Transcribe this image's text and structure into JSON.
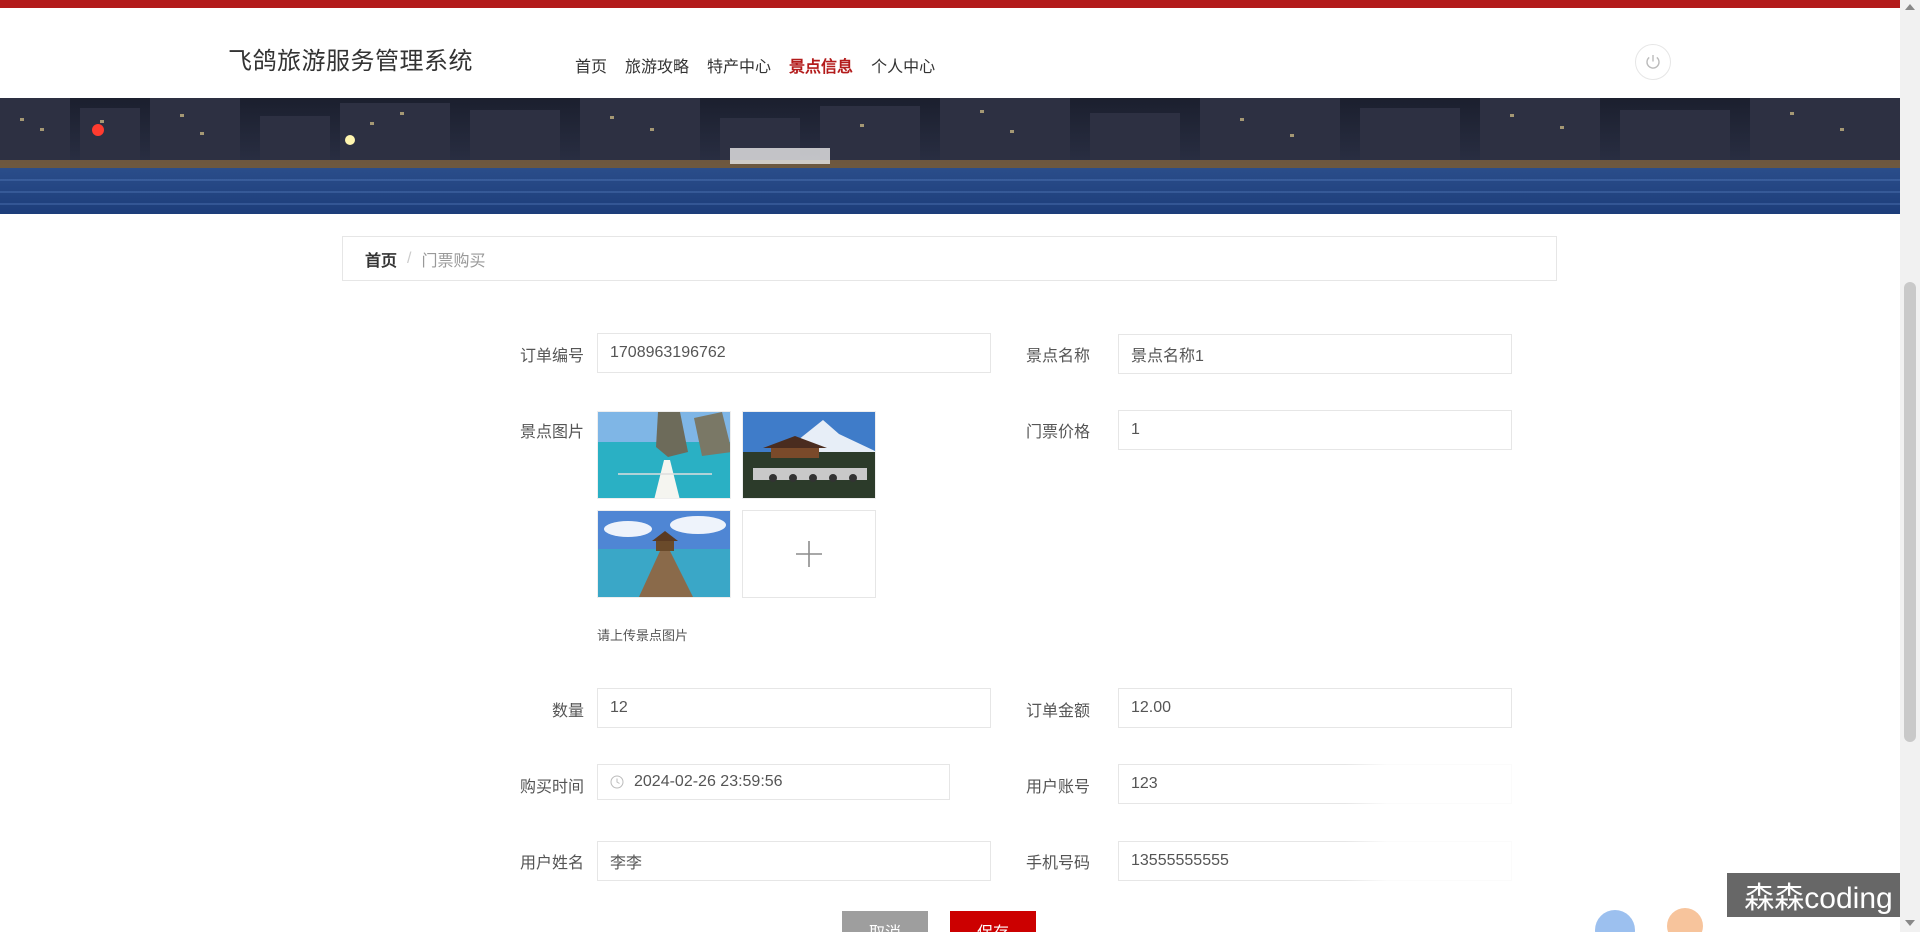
{
  "header": {
    "site_title": "飞鸽旅游服务管理系统",
    "nav": [
      "首页",
      "旅游攻略",
      "特产中心",
      "景点信息",
      "个人中心"
    ],
    "active_nav": "景点信息",
    "power_icon": "power-icon"
  },
  "breadcrumb": {
    "home": "首页",
    "separator": "/",
    "current": "门票购买"
  },
  "form": {
    "order_no_label": "订单编号",
    "order_no_value": "1708963196762",
    "scenic_name_label": "景点名称",
    "scenic_name_value": "景点名称1",
    "scenic_image_label": "景点图片",
    "upload_hint": "请上传景点图片",
    "ticket_price_label": "门票价格",
    "ticket_price_value": "1",
    "quantity_label": "数量",
    "quantity_value": "12",
    "order_amount_label": "订单金额",
    "order_amount_value": "12.00",
    "purchase_time_label": "购买时间",
    "purchase_time_value": "2024-02-26 23:59:56",
    "user_account_label": "用户账号",
    "user_account_value": "123",
    "user_name_label": "用户姓名",
    "user_name_value": "李李",
    "phone_label": "手机号码",
    "phone_value": "13555555555"
  },
  "buttons": {
    "cancel": "取消",
    "save": "保存"
  },
  "watermark": "森森coding",
  "colors": {
    "accent": "#b31b1b",
    "save_button": "#cc0000",
    "cancel_button": "#9e9e9e"
  }
}
